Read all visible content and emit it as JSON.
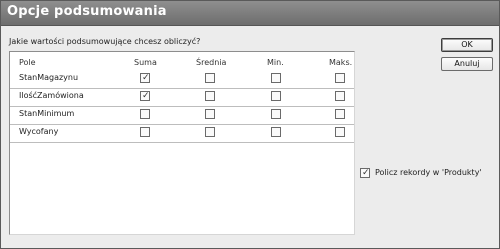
{
  "window": {
    "title": "Opcje podsumowania"
  },
  "prompt": "Jakie wartości podsumowujące chcesz obliczyć?",
  "table": {
    "headers": [
      "Pole",
      "Suma",
      "Średnia",
      "Min.",
      "Maks."
    ],
    "rows": [
      {
        "field": "StanMagazynu",
        "suma": true,
        "srednia": false,
        "min": false,
        "maks": false
      },
      {
        "field": "IlośćZamówiona",
        "suma": true,
        "srednia": false,
        "min": false,
        "maks": false
      },
      {
        "field": "StanMinimum",
        "suma": false,
        "srednia": false,
        "min": false,
        "maks": false
      },
      {
        "field": "Wycofany",
        "suma": false,
        "srednia": false,
        "min": false,
        "maks": false
      }
    ]
  },
  "buttons": {
    "ok": "OK",
    "cancel": "Anuluj"
  },
  "count_records": {
    "label": "Policz rekordy w 'Produkty'",
    "checked": true
  },
  "check_glyph": "✓"
}
